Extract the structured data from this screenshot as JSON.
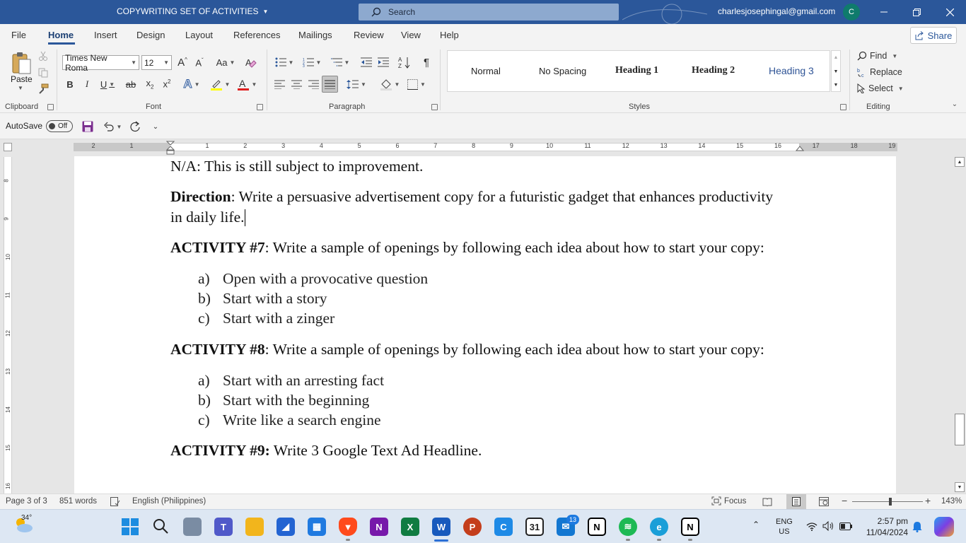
{
  "window": {
    "doc_title": "COPYWRITING SET OF ACTIVITIES",
    "search_placeholder": "Search",
    "account_email": "charlesjosephingal@gmail.com",
    "avatar_initial": "C"
  },
  "menu": {
    "tabs": [
      "File",
      "Home",
      "Insert",
      "Design",
      "Layout",
      "References",
      "Mailings",
      "Review",
      "View",
      "Help"
    ],
    "active": "Home",
    "share_label": "Share"
  },
  "ribbon": {
    "clipboard": {
      "label": "Clipboard",
      "paste_label": "Paste"
    },
    "font": {
      "label": "Font",
      "name": "Times New Roma",
      "size": "12"
    },
    "paragraph": {
      "label": "Paragraph"
    },
    "styles": {
      "label": "Styles",
      "items": [
        "Normal",
        "No Spacing",
        "Heading 1",
        "Heading 2",
        "Heading 3"
      ]
    },
    "editing": {
      "label": "Editing",
      "find": "Find",
      "replace": "Replace",
      "select": "Select"
    }
  },
  "qat": {
    "autosave_label": "AutoSave",
    "autosave_state": "Off"
  },
  "ruler": {
    "numbers": [
      "2",
      "1",
      "1",
      "2",
      "3",
      "4",
      "5",
      "6",
      "7",
      "8",
      "9",
      "10",
      "11",
      "12",
      "13",
      "14",
      "15",
      "16",
      "17",
      "18",
      "19"
    ]
  },
  "vruler": {
    "numbers": [
      "8",
      "9",
      "10",
      "11",
      "12",
      "13",
      "14",
      "15",
      "16"
    ]
  },
  "document": {
    "line1": "N/A: This is still subject to improvement.",
    "direction_label": "Direction",
    "direction_text_1": ": Write a persuasive advertisement copy for a futuristic gadget that enhances productivity",
    "direction_text_2": "in daily life.",
    "activity7_label": "ACTIVITY #7",
    "activity7_text": ": Write a sample of openings by following each idea about how to start your copy:",
    "activity7_items": [
      {
        "marker": "a)",
        "text": "Open with a provocative question"
      },
      {
        "marker": "b)",
        "text": "Start with a story"
      },
      {
        "marker": "c)",
        "text": "Start with a zinger"
      }
    ],
    "activity8_label": "ACTIVITY #8",
    "activity8_text": ": Write a sample of openings by following each idea about how to start your copy:",
    "activity8_items": [
      {
        "marker": "a)",
        "text": "Start with an arresting fact"
      },
      {
        "marker": "b)",
        "text": "Start with the beginning"
      },
      {
        "marker": "c)",
        "text": "Write like a search engine"
      }
    ],
    "activity9_label": "ACTIVITY #9:",
    "activity9_text": " Write 3 Google Text Ad Headline."
  },
  "status": {
    "page": "Page 3 of 3",
    "words": "851 words",
    "language": "English (Philippines)",
    "focus": "Focus",
    "zoom": "143%"
  },
  "taskbar": {
    "weather": "34°",
    "badge_count": "13",
    "calendar_day": "31",
    "lang_top": "ENG",
    "lang_bottom": "US",
    "time": "2:57 pm",
    "date": "11/04/2024"
  },
  "colors": {
    "titlebar": "#2b579a",
    "accent": "#2b579a",
    "heading3": "#2f5496"
  }
}
